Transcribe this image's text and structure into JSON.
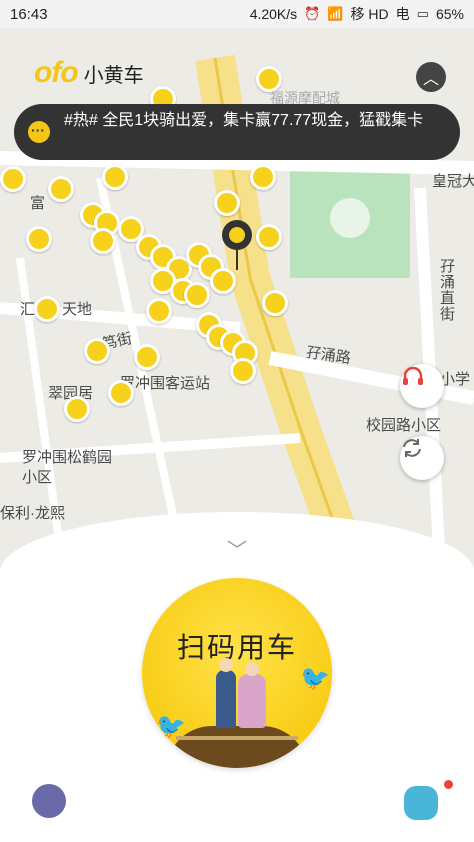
{
  "status_bar": {
    "time": "16:43",
    "speed": "4.20K/s",
    "carrier1": "移 HD",
    "carrier2": "电",
    "battery": "65%"
  },
  "app": {
    "logo": "ofo",
    "name": "小黄车"
  },
  "notice": {
    "text": "#热# 全民1块骑出爱，集卡赢77.77现金，猛戳集卡"
  },
  "map_labels": [
    "富",
    "汇",
    "天地",
    "笃街",
    "罗冲围客运站",
    "翠园居",
    "罗冲围松鹤园小区",
    "保利·龙熙",
    "校园路小区",
    "孖涌路",
    "孖涌直街",
    "皇冠大",
    "小学",
    "福源摩配城"
  ],
  "bottom": {
    "scan_label": "扫码用车"
  },
  "icons": {
    "collapse": "chevron-up-icon",
    "service": "headset-icon",
    "refresh": "refresh-icon",
    "expand": "chevron-down-icon",
    "left_corner": "magpie-badge-icon",
    "right_corner": "cloud-lock-icon"
  },
  "colors": {
    "brand_yellow": "#f7d21c",
    "notice_bg": "#333333",
    "service_red": "#e8433a"
  }
}
